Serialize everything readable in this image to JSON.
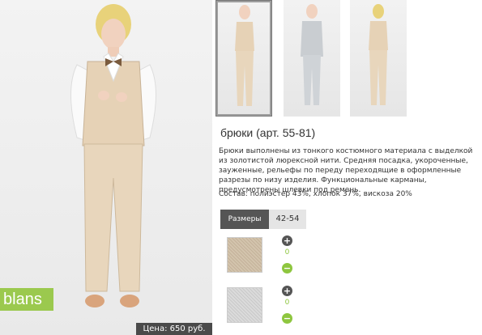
{
  "product": {
    "title": "брюки (арт. 55-81)",
    "description": "Брюки выполнены из тонкого костюмного материала с выделкой из золотистой люрексной нити. Средняя посадка, укороченные, зауженные, рельефы по переду переходящие в оформленные разрезы по низу изделия. Функциональные карманы, предусмотрены шлевки под ремень.",
    "composition": "Состав: полиэстер 43%, хлопок 37%, вискоза 20%",
    "price": "Цена: 650 руб.",
    "brand": "blans"
  },
  "sizes": {
    "label": "Размеры",
    "value": "42-54"
  },
  "colors": [
    {
      "swatch": "beige-fabric",
      "color": "#cbbba3",
      "quantity": "0"
    },
    {
      "swatch": "grey-fabric",
      "color": "#d2d2d2",
      "quantity": "0"
    }
  ],
  "icons": {
    "plus": "+",
    "minus": "−"
  }
}
